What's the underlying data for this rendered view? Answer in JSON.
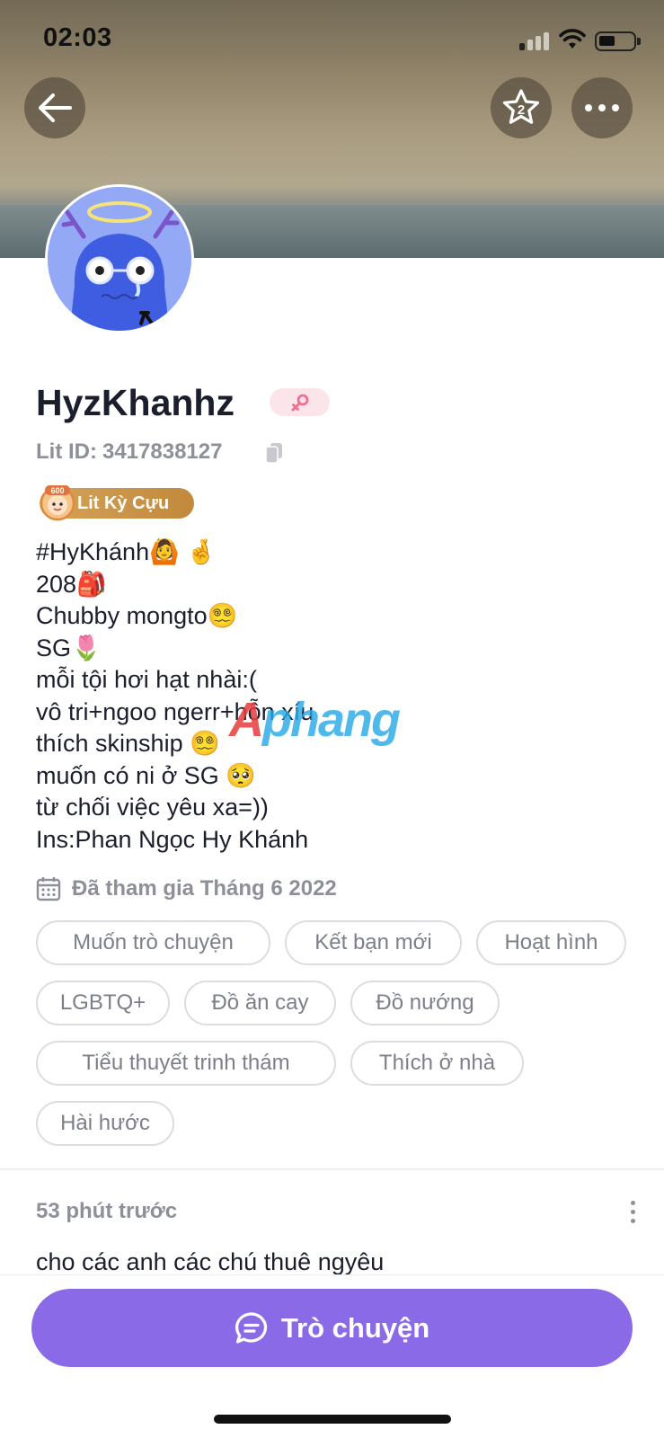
{
  "status_bar": {
    "time": "02:03"
  },
  "header": {
    "back_icon": "arrow-left-icon",
    "star_icon": "star-badge-icon",
    "star_badge_number": "2",
    "more_icon": "more-horizontal-icon"
  },
  "profile": {
    "name": "HyzKhanhz",
    "gender_icon": "female-symbol-icon",
    "lit_id_label": "Lit ID:",
    "lit_id_value": "3417838127",
    "rank_label": "Lit Kỳ Cựu",
    "rank_medal_number": "600",
    "bio_lines": [
      "#HyKhánh🙆 🤞",
      "208🎒",
      "Chubby mongto😵‍💫",
      "SG🌷",
      "mỗi tội hơi hạt nhài:(",
      "vô tri+ngoo ngerr+hỗn xíu",
      "thích skinship 😵‍💫",
      "muốn có ni ở SG 🥺",
      "từ chối việc yêu xa=))",
      "Ins:Phan Ngọc Hy Khánh"
    ],
    "joined": "Đã tham gia Tháng 6 2022",
    "tags": [
      "Muốn trò chuyện",
      "Kết bạn mới",
      "Hoạt hình",
      "LGBTQ+",
      "Đồ ăn cay",
      "Đồ nướng",
      "Tiểu thuyết trinh thám",
      "Thích ở nhà",
      "Hài hước"
    ]
  },
  "watermark": {
    "prefix": "A",
    "rest": "phang"
  },
  "post": {
    "time": "53 phút trước",
    "text": "cho các anh các chú thuê ngyêu"
  },
  "chat_button": {
    "label": "Trò chuyện",
    "icon": "chat-bubble-icon"
  },
  "colors": {
    "accent": "#8a6ae6",
    "avatar_bg": "#93a9f5",
    "rank_gold": "#c99446"
  }
}
